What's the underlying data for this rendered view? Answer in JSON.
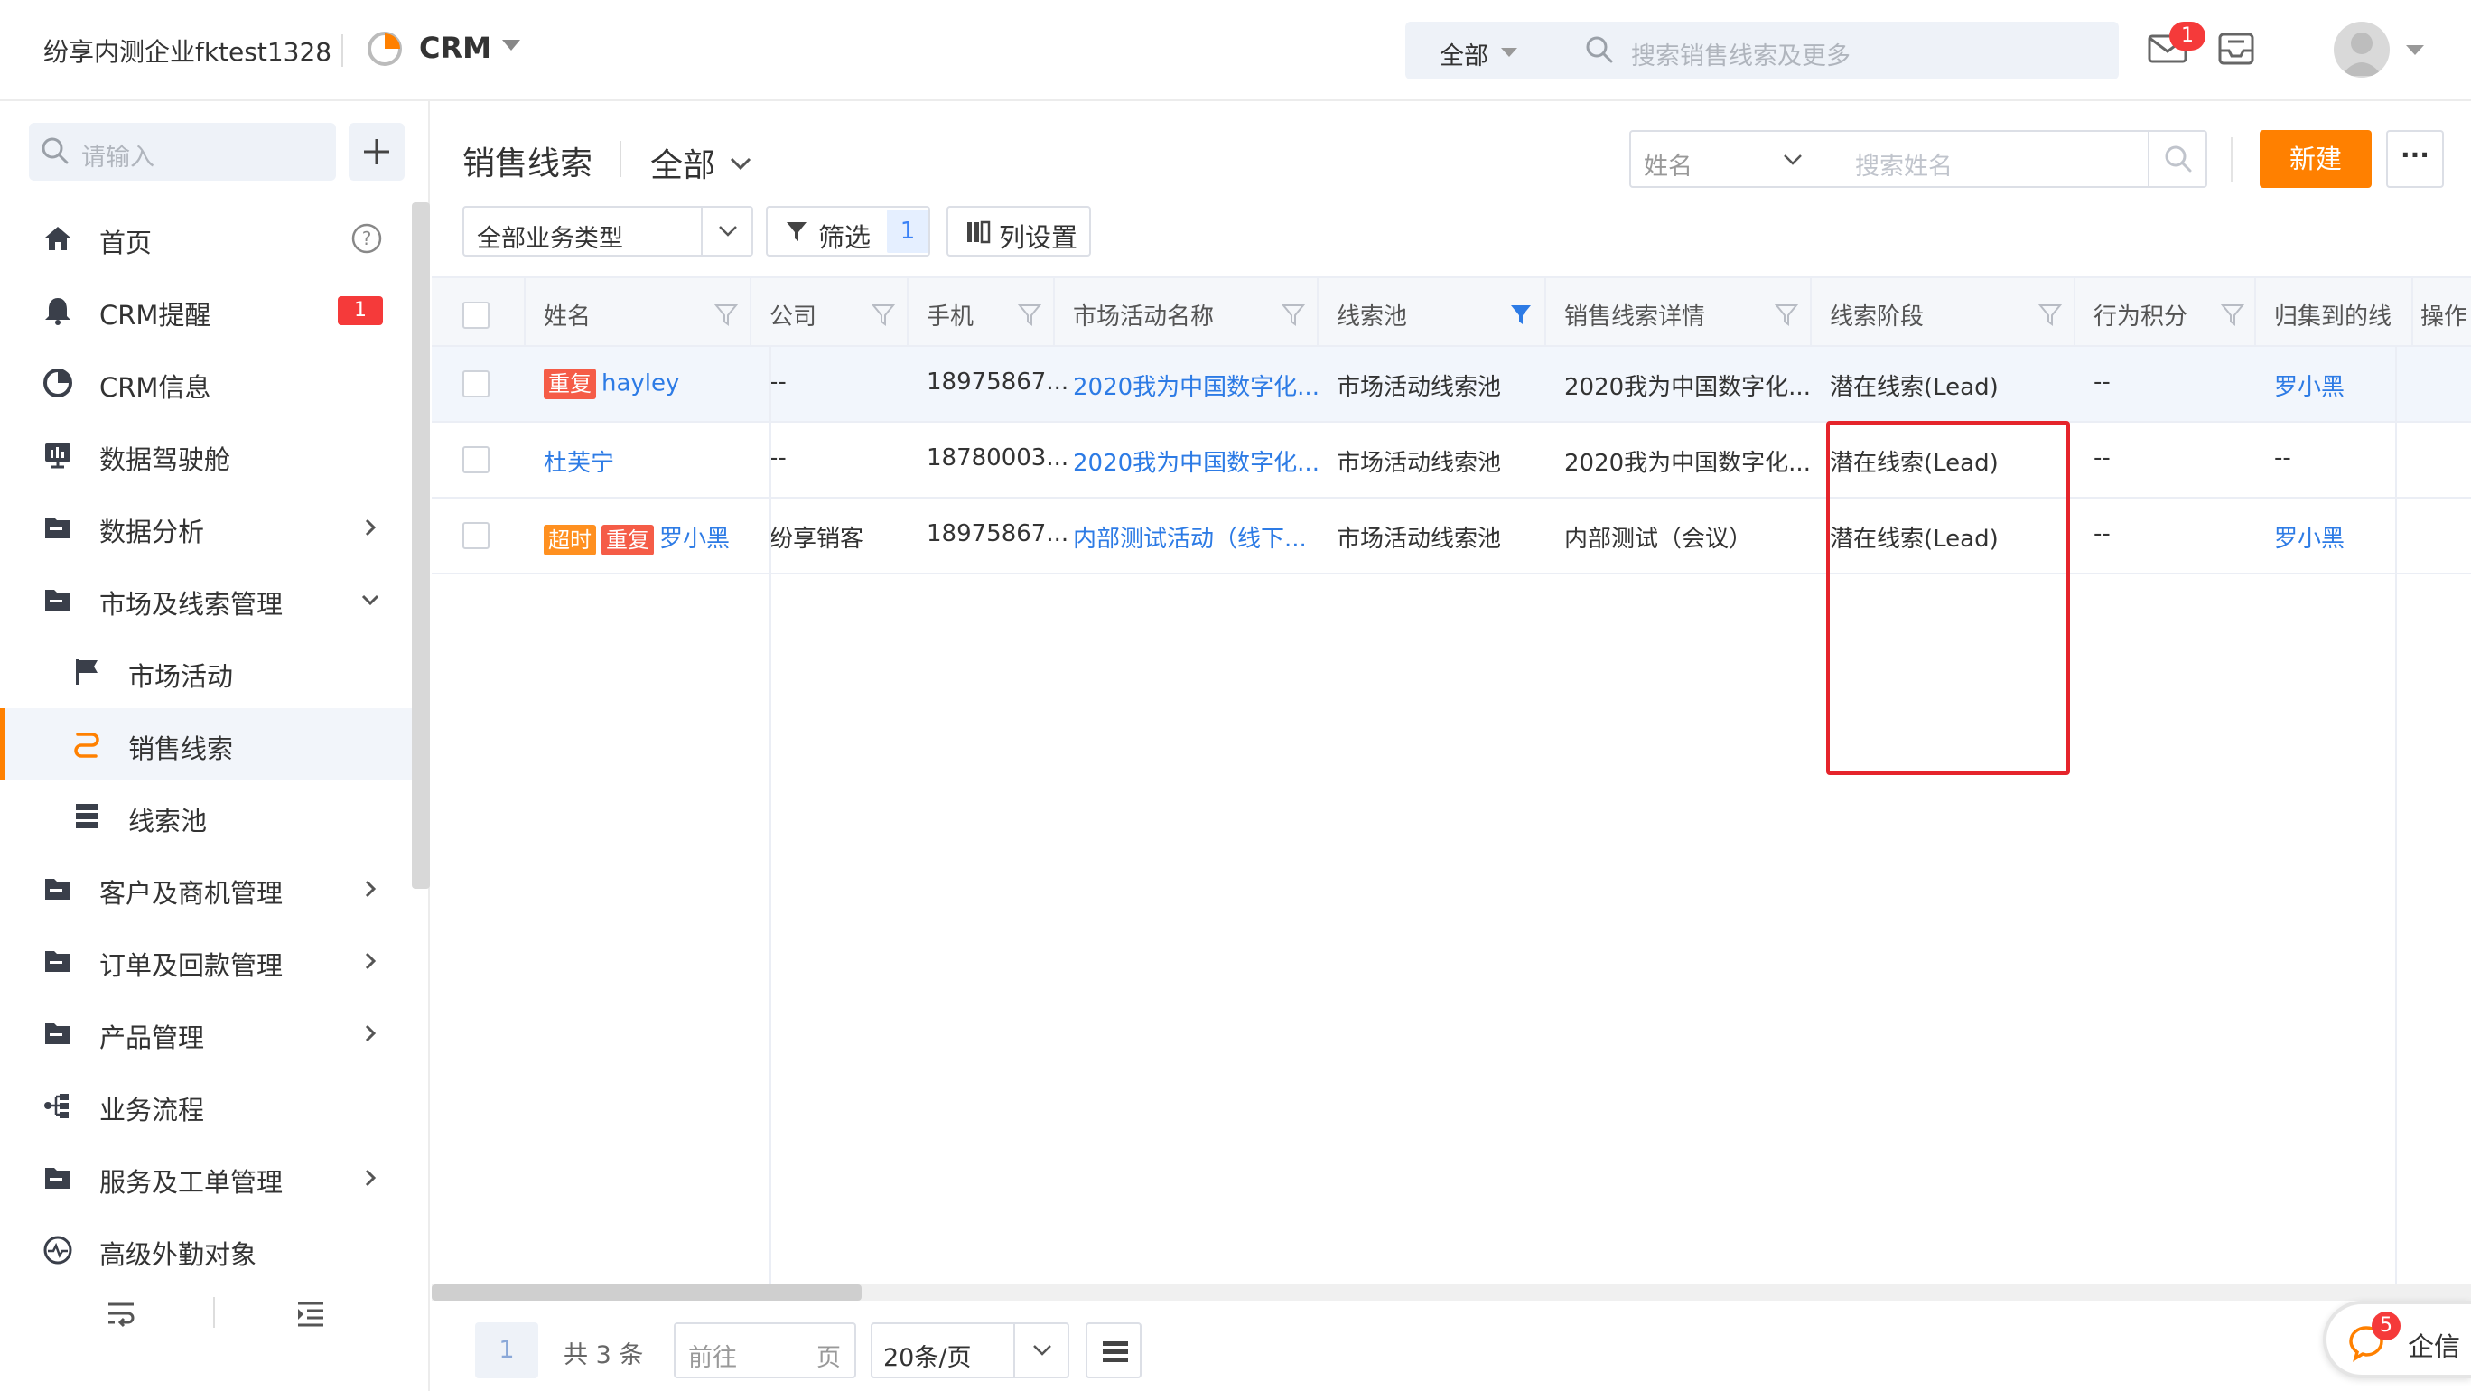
{
  "topbar": {
    "company": "纷享内测企业fktest1328",
    "app_name": "CRM",
    "search_scope": "全部",
    "search_placeholder": "搜索销售线索及更多",
    "mail_badge": "1"
  },
  "sidebar": {
    "search_placeholder": "请输入",
    "items": [
      {
        "label": "首页",
        "icon": "home-icon"
      },
      {
        "label": "CRM提醒",
        "icon": "bell-icon",
        "badge": "1"
      },
      {
        "label": "CRM信息",
        "icon": "pie-icon"
      },
      {
        "label": "数据驾驶舱",
        "icon": "dashboard-icon"
      },
      {
        "label": "数据分析",
        "icon": "folder-icon"
      },
      {
        "label": "市场及线索管理",
        "icon": "folder-icon"
      },
      {
        "label": "市场活动",
        "icon": "flag-icon"
      },
      {
        "label": "销售线索",
        "icon": "lead-icon"
      },
      {
        "label": "线索池",
        "icon": "pool-icon"
      },
      {
        "label": "客户及商机管理",
        "icon": "folder-icon"
      },
      {
        "label": "订单及回款管理",
        "icon": "folder-icon"
      },
      {
        "label": "产品管理",
        "icon": "folder-icon"
      },
      {
        "label": "业务流程",
        "icon": "flow-icon"
      },
      {
        "label": "服务及工单管理",
        "icon": "folder-icon"
      },
      {
        "label": "高级外勤对象",
        "icon": "wave-icon"
      }
    ]
  },
  "header": {
    "title": "销售线索",
    "view": "全部",
    "search_field": "姓名",
    "search_placeholder": "搜索姓名",
    "new_label": "新建",
    "more_label": "···",
    "biz_type": "全部业务类型",
    "filter_label": "筛选",
    "filter_count": "1",
    "columns_label": "列设置"
  },
  "table": {
    "columns": [
      "姓名",
      "公司",
      "手机",
      "市场活动名称",
      "线索池",
      "销售线索详情",
      "线索阶段",
      "行为积分",
      "归集到的线",
      "操作"
    ],
    "rows": [
      {
        "tags": [
          "重复"
        ],
        "name": "hayley",
        "company": "--",
        "phone": "18975867...",
        "campaign": "2020我为中国数字化...",
        "pool": "市场活动线索池",
        "detail": "2020我为中国数字化...",
        "stage": "潜在线索(Lead)",
        "score": "--",
        "owner": "罗小黑"
      },
      {
        "tags": [],
        "name": "杜芙宁",
        "company": "--",
        "phone": "18780003...",
        "campaign": "2020我为中国数字化...",
        "pool": "市场活动线索池",
        "detail": "2020我为中国数字化...",
        "stage": "潜在线索(Lead)",
        "score": "--",
        "owner": "--"
      },
      {
        "tags": [
          "超时",
          "重复"
        ],
        "name": "罗小黑",
        "company": "纷享销客",
        "phone": "18975867...",
        "campaign": "内部测试活动（线下...",
        "pool": "市场活动线索池",
        "detail": "内部测试（会议）",
        "stage": "潜在线索(Lead)",
        "score": "--",
        "owner": "罗小黑"
      }
    ]
  },
  "pager": {
    "page": "1",
    "total": "共 3 条",
    "goto_prefix": "前往",
    "goto_suffix": "页",
    "page_size": "20条/页"
  },
  "float": {
    "label": "企信",
    "badge": "5"
  },
  "colors": {
    "accent": "#ff8000",
    "link": "#2d7be5",
    "badge": "#f53a3a",
    "highlight": "#e5242b"
  }
}
